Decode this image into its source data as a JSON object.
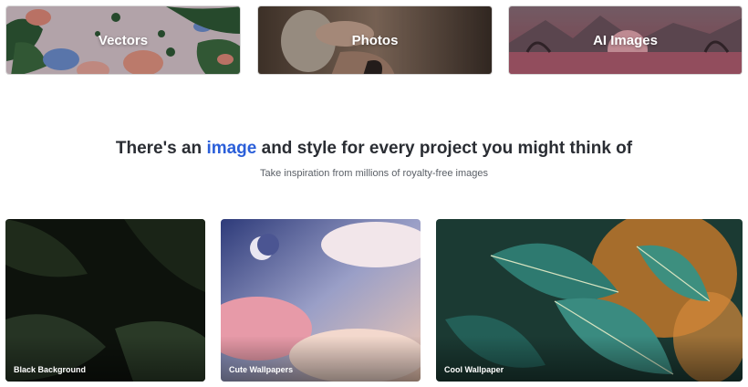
{
  "categories": {
    "vectors": "Vectors",
    "photos": "Photos",
    "ai_images": "AI Images"
  },
  "headline": {
    "before": "There's an ",
    "accent": "image",
    "after": " and style for every project you might think of"
  },
  "subline": "Take inspiration from millions of royalty-free images",
  "gallery": {
    "black_background": "Black Background",
    "cute_wallpapers": "Cute Wallpapers",
    "cool_wallpaper": "Cool Wallpaper"
  },
  "colors": {
    "accent": "#2b5fd9",
    "headline": "#2a2d33",
    "subline": "#5a5f66"
  }
}
